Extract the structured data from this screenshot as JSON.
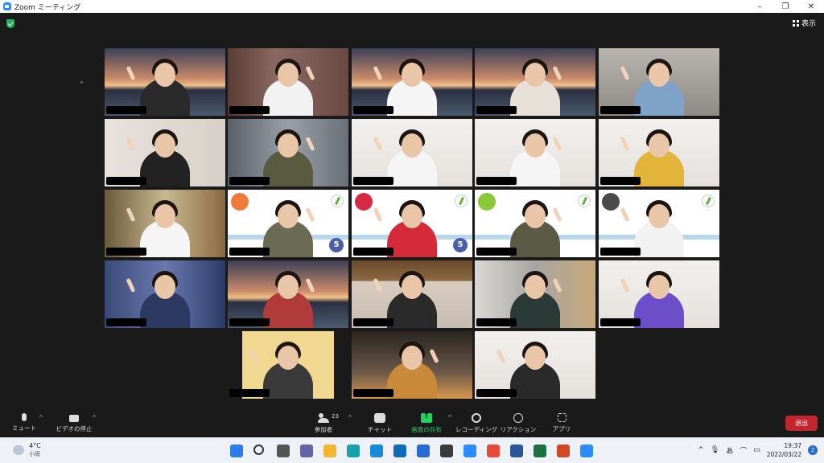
{
  "window": {
    "title": "Zoom ミーティング",
    "minimize_label": "–",
    "maximize_label": "❐",
    "close_label": "✕"
  },
  "header": {
    "view_label": "表示"
  },
  "gallery": {
    "tiles": [
      {
        "id": "r1c1",
        "scene": "sunset",
        "shirt": "#2a2a2a",
        "active": false
      },
      {
        "id": "r1c2",
        "scene": "curtain",
        "shirt": "#f2f2f2",
        "active": true
      },
      {
        "id": "r1c3",
        "scene": "sunset",
        "shirt": "#f5f5f5",
        "active": false
      },
      {
        "id": "r1c4",
        "scene": "sunset",
        "shirt": "#e6e0d8",
        "active": false
      },
      {
        "id": "r1c5",
        "scene": "room",
        "shirt": "#7ea2c8",
        "active": false
      },
      {
        "id": "r2c1",
        "scene": "wall",
        "shirt": "#222222",
        "active": false
      },
      {
        "id": "r2c2",
        "scene": "kitchen",
        "shirt": "#5a5a40",
        "active": false
      },
      {
        "id": "r2c3",
        "scene": "plain",
        "shirt": "#f5f5f5",
        "active": false
      },
      {
        "id": "r2c4",
        "scene": "plain",
        "shirt": "#f5f5f5",
        "active": false
      },
      {
        "id": "r2c5",
        "scene": "plain",
        "shirt": "#e2b53a",
        "active": false
      },
      {
        "id": "r3c1",
        "scene": "door",
        "shirt": "#f5f5f5",
        "active": false
      },
      {
        "id": "r3c2",
        "scene": "card-orange",
        "shirt": "#6b6a52",
        "active": false
      },
      {
        "id": "r3c3",
        "scene": "card-red",
        "shirt": "#d42a3a",
        "active": false
      },
      {
        "id": "r3c4",
        "scene": "card-green",
        "shirt": "#5b5a44",
        "active": false
      },
      {
        "id": "r3c5",
        "scene": "card-gray",
        "shirt": "#f2f2f2",
        "active": false
      },
      {
        "id": "r4c1",
        "scene": "blue-room",
        "shirt": "#2c3a62",
        "active": false
      },
      {
        "id": "r4c2",
        "scene": "sunset",
        "shirt": "#b13a3a",
        "active": false
      },
      {
        "id": "r4c3",
        "scene": "wood",
        "shirt": "#2a2a2a",
        "active": false
      },
      {
        "id": "r4c4",
        "scene": "curtain-light",
        "shirt": "#2a3a36",
        "active": false
      },
      {
        "id": "r4c5",
        "scene": "plain",
        "shirt": "#6b4ec8",
        "active": false
      },
      {
        "id": "r5c1",
        "scene": "warm",
        "shirt": "#3a3a3a",
        "active": false
      },
      {
        "id": "r5c2",
        "scene": "dark-room",
        "shirt": "#c88a3a",
        "active": false
      },
      {
        "id": "r5c3",
        "scene": "plain",
        "shirt": "#2a2a2a",
        "active": false
      }
    ],
    "badges": [
      "5",
      "5"
    ]
  },
  "toolbar": {
    "mute_label": "ミュート",
    "video_label": "ビデオの停止",
    "participants_label": "参加者",
    "participants_count": "23",
    "chat_label": "チャット",
    "share_label": "画面の共有",
    "record_label": "レコーディング",
    "reactions_label": "リアクション",
    "apps_label": "アプリ",
    "leave_label": "退出",
    "caret": "^"
  },
  "taskbar": {
    "weather_temp": "4°C",
    "weather_cond": "小雨",
    "apps": [
      "windows-start",
      "search",
      "task-view",
      "teams-chat",
      "file-explorer",
      "store-app",
      "edge",
      "mail",
      "store",
      "camera",
      "zoom",
      "chrome",
      "word",
      "excel",
      "powerpoint",
      "zoom-meeting"
    ],
    "tray_chevron": "^",
    "ime": "あ",
    "time": "19:37",
    "date": "2022/03/22",
    "notifications": "2"
  },
  "colors": {
    "share_green": "#23d160",
    "leave_red": "#c4262e",
    "active_speaker": "#d6e05a",
    "meeting_bg": "#1a1a1a"
  }
}
